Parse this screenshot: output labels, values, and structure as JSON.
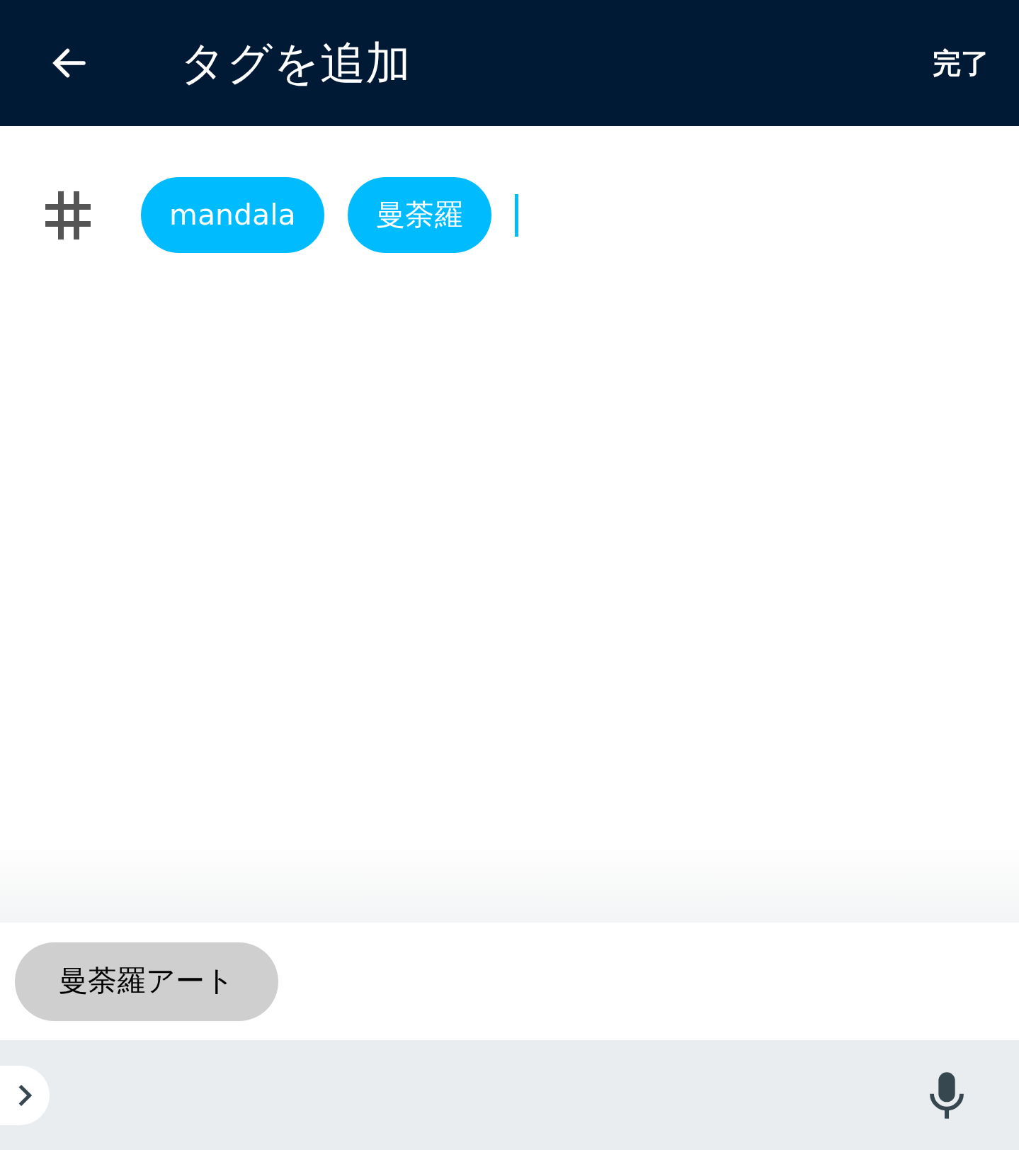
{
  "header": {
    "title": "タグを追加",
    "done": "完了"
  },
  "tags": [
    {
      "label": "mandala"
    },
    {
      "label": "曼荼羅"
    }
  ],
  "input": {
    "focused": true
  },
  "suggestions": [
    {
      "label": "曼荼羅アート"
    }
  ]
}
